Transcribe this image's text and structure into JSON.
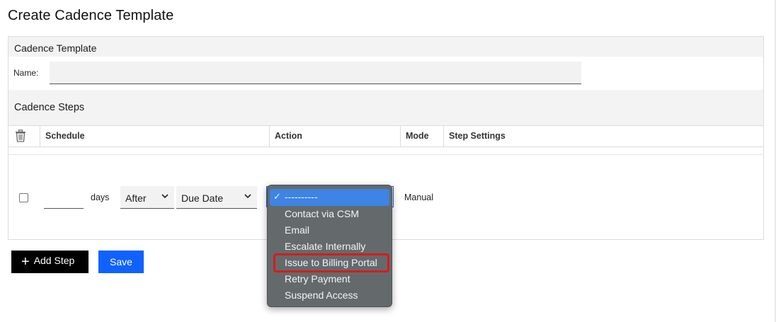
{
  "page": {
    "title": "Create Cadence Template"
  },
  "template_section": {
    "title": "Cadence Template",
    "name_label": "Name:",
    "name_value": "",
    "name_placeholder": ""
  },
  "steps_section": {
    "title": "Cadence Steps",
    "columns": [
      "Schedule",
      "Action",
      "Mode",
      "Step Settings"
    ],
    "rows": [
      {
        "checked": false,
        "days_value": "",
        "days_label": "days",
        "timing": "After",
        "reference": "Due Date",
        "action": "----------",
        "mode": "Manual"
      }
    ]
  },
  "action_dropdown": {
    "open": true,
    "selected_index": 0,
    "highlighted_index": 4,
    "options": [
      "----------",
      "Contact via CSM",
      "Email",
      "Escalate Internally",
      "Issue to Billing Portal",
      "Retry Payment",
      "Suspend Access"
    ],
    "check_glyph": "✓"
  },
  "buttons": {
    "add_step": "Add Step",
    "add_step_icon": "plus-icon",
    "save": "Save"
  },
  "colors": {
    "primary": "#0f62fe",
    "dark_button": "#000000",
    "dropdown_bg": "#646a6c",
    "dropdown_selected": "#3d84e5",
    "highlight_border": "#d61c1c"
  },
  "icons": {
    "delete_column": "trash-icon",
    "select_arrow": "chevron-down-icon"
  }
}
